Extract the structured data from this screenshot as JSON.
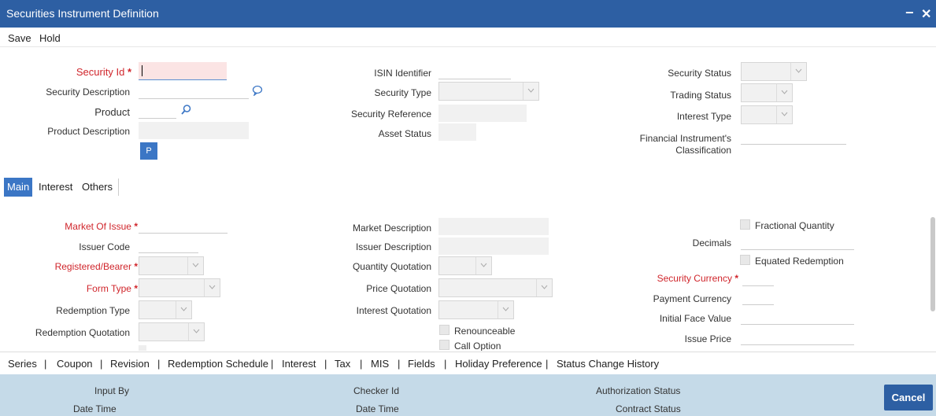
{
  "window": {
    "title": "Securities Instrument Definition",
    "minimize": "−",
    "close": "✕"
  },
  "menu": {
    "save": "Save",
    "hold": "Hold"
  },
  "header": {
    "security_id": "Security Id",
    "security_description": "Security Description",
    "product": "Product",
    "product_description": "Product Description",
    "p_button": "P",
    "isin_identifier": "ISIN Identifier",
    "security_type": "Security Type",
    "security_reference": "Security Reference",
    "asset_status": "Asset Status",
    "security_status": "Security Status",
    "trading_status": "Trading Status",
    "interest_type": "Interest Type",
    "fin_class_line1": "Financial Instrument's",
    "fin_class_line2": "Classification",
    "required_marker": "*"
  },
  "tabs": {
    "main": "Main",
    "interest": "Interest",
    "others": "Others"
  },
  "main": {
    "market_of_issue": "Market Of Issue",
    "issuer_code": "Issuer Code",
    "registered_bearer": "Registered/Bearer",
    "form_type": "Form Type",
    "redemption_type": "Redemption Type",
    "redemption_quotation": "Redemption Quotation",
    "market_description": "Market Description",
    "issuer_description": "Issuer Description",
    "quantity_quotation": "Quantity Quotation",
    "price_quotation": "Price Quotation",
    "interest_quotation": "Interest Quotation",
    "renounceable": "Renounceable",
    "call_option": "Call Option",
    "fractional_quantity": "Fractional Quantity",
    "decimals": "Decimals",
    "equated_redemption": "Equated Redemption",
    "security_currency": "Security Currency",
    "payment_currency": "Payment Currency",
    "initial_face_value": "Initial Face Value",
    "issue_price": "Issue Price"
  },
  "subscreens": [
    "Series",
    "Coupon",
    "Revision",
    "Redemption Schedule",
    "Interest",
    "Tax",
    "MIS",
    "Fields",
    "Holiday Preference",
    "Status Change History"
  ],
  "separator": "|",
  "footer": {
    "input_by": "Input By",
    "date_time": "Date Time",
    "checker_id": "Checker Id",
    "date_time_2": "Date Time",
    "authorization_status": "Authorization Status",
    "contract_status": "Contract Status",
    "cancel": "Cancel"
  },
  "colors": {
    "titlebar": "#2d5fa3",
    "required": "#d0252b",
    "footer": "#c5dae8",
    "accent": "#3b76c5"
  }
}
